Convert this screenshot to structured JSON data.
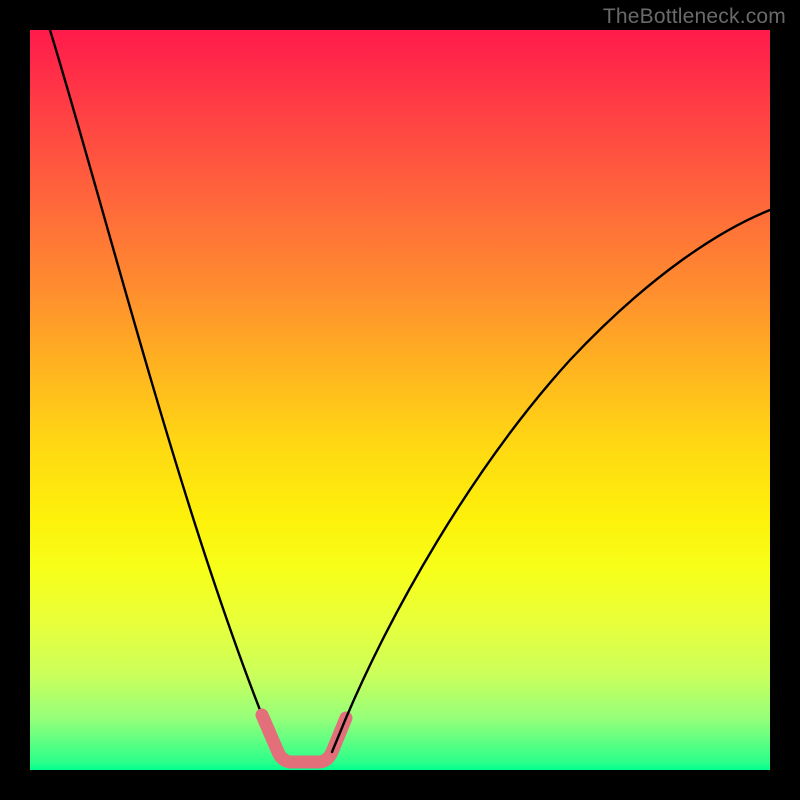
{
  "watermark": "TheBottleneck.com",
  "chart_data": {
    "type": "line",
    "title": "",
    "xlabel": "",
    "ylabel": "",
    "xlim": [
      0,
      100
    ],
    "ylim": [
      0,
      100
    ],
    "grid": false,
    "legend": false,
    "description": "Bottleneck / mismatch curve over a rainbow gradient background. Y roughly encodes bottleneck percentage (red = high, green = low). Two branches meet near x≈33 at y≈0 forming a V with a flat bottom; left branch is steep starting at y=100 at x=0, right branch rises gently to y≈65 at x=100.",
    "series": [
      {
        "name": "left-branch",
        "x": [
          0,
          4,
          8,
          12,
          16,
          20,
          24,
          28,
          30,
          32,
          33
        ],
        "y": [
          100,
          90,
          78,
          66,
          54,
          42,
          30,
          16,
          8,
          2,
          0
        ]
      },
      {
        "name": "right-branch",
        "x": [
          38,
          40,
          44,
          50,
          56,
          64,
          72,
          80,
          88,
          96,
          100
        ],
        "y": [
          0,
          3,
          10,
          20,
          29,
          38,
          46,
          53,
          58,
          62,
          65
        ]
      },
      {
        "name": "flat-bottom-highlight",
        "x": [
          29,
          31,
          33,
          35,
          37,
          39
        ],
        "y": [
          7,
          2,
          0,
          0,
          2,
          7
        ]
      }
    ],
    "colors": {
      "gradient_top": "#ff1a4b",
      "gradient_mid": "#fdf10a",
      "gradient_bottom": "#00ff8f",
      "line": "#000000",
      "highlight": "#e26f79"
    }
  }
}
